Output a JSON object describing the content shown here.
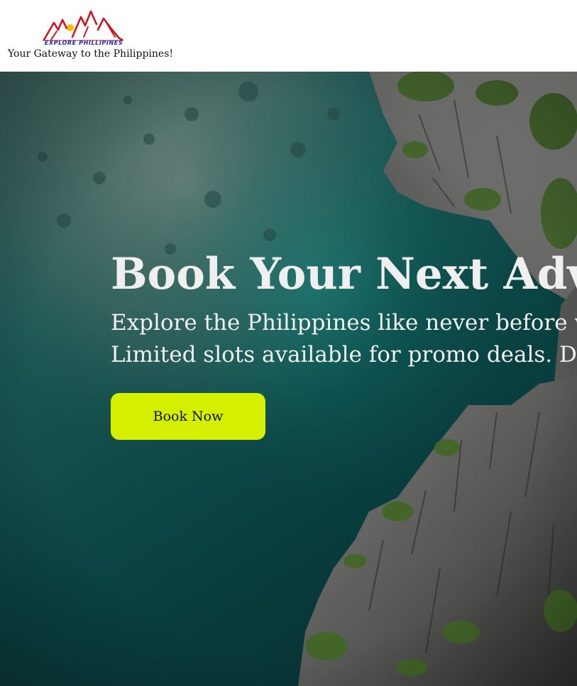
{
  "header": {
    "logo": {
      "icon": "mountains-sun-logo",
      "text": "EXPLORE PHILLIPINES"
    },
    "tagline": "Your Gateway to the Philippines!"
  },
  "hero": {
    "background": "aerial-lagoon-limestone-cliffs",
    "title": "Book Your Next Adv",
    "subtitle_line1": "Explore the Philippines like never before w",
    "subtitle_line2": "Limited slots available for promo deals. Do",
    "cta_label": "Book Now"
  },
  "colors": {
    "cta": "#d4f000",
    "logo_red": "#d2141c",
    "logo_blue": "#1b2bb0",
    "sun": "#f2c200"
  }
}
